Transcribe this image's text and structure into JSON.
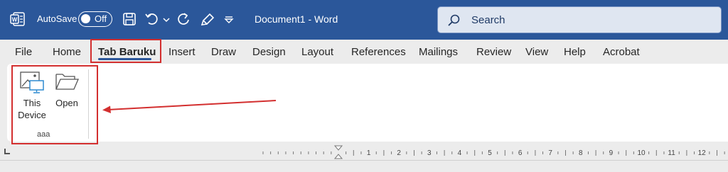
{
  "titlebar": {
    "autosave_label": "AutoSave",
    "autosave_state": "Off",
    "document_title": "Document1 - Word",
    "search_placeholder": "Search",
    "bg_color": "#2b579a"
  },
  "menu": {
    "tabs": [
      {
        "label": "File"
      },
      {
        "label": "Home"
      },
      {
        "label": "Tab Baruku",
        "active": true
      },
      {
        "label": "Insert"
      },
      {
        "label": "Draw"
      },
      {
        "label": "Design"
      },
      {
        "label": "Layout"
      },
      {
        "label": "References"
      },
      {
        "label": "Mailings"
      },
      {
        "label": "Review"
      },
      {
        "label": "View"
      },
      {
        "label": "Help"
      },
      {
        "label": "Acrobat"
      }
    ]
  },
  "ribbon": {
    "group_label": "aaa",
    "buttons": [
      {
        "label_line1": "This",
        "label_line2": "Device",
        "icon": "this-device-icon"
      },
      {
        "label_line1": "Open",
        "icon": "folder-open-icon"
      }
    ]
  },
  "ruler": {
    "numbers": [
      "1",
      "2",
      "3",
      "4",
      "5",
      "6",
      "7",
      "8",
      "9",
      "10",
      "11",
      "12"
    ]
  },
  "annotation": {
    "highlight_color": "#d32f2f"
  }
}
